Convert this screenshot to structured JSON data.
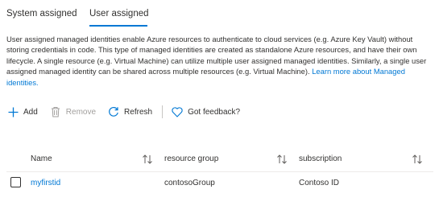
{
  "tabs": {
    "system_assigned": "System assigned",
    "user_assigned": "User assigned",
    "active": "user_assigned"
  },
  "description": {
    "text": "User assigned managed identities enable Azure resources to authenticate to cloud services (e.g. Azure Key Vault) without storing credentials in code. This type of managed identities are created as standalone Azure resources, and have their own lifecycle. A single resource (e.g. Virtual Machine) can utilize multiple user assigned managed identities. Similarly, a single user assigned managed identity can be shared across multiple resources (e.g. Virtual Machine).",
    "learn_more": "Learn more about Managed identities."
  },
  "toolbar": {
    "add": "Add",
    "remove": "Remove",
    "refresh": "Refresh",
    "feedback": "Got feedback?"
  },
  "table": {
    "columns": [
      "Name",
      "resource group",
      "subscription"
    ],
    "rows": [
      {
        "name": "myfirstid",
        "resource_group": "contosoGroup",
        "subscription": "Contoso ID"
      }
    ]
  },
  "colors": {
    "accent": "#0078d4",
    "text": "#323130",
    "disabled": "#a19f9d"
  }
}
